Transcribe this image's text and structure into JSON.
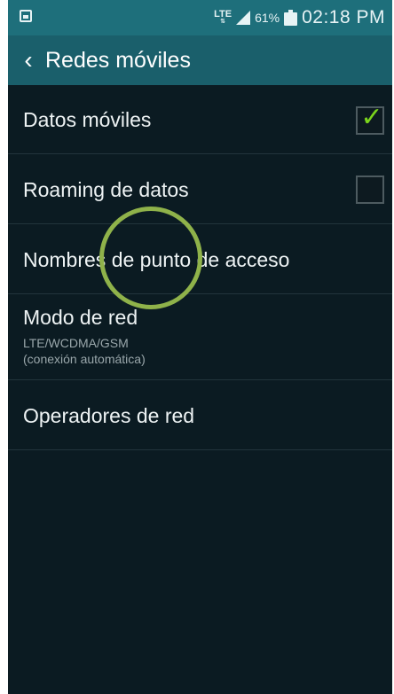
{
  "status_bar": {
    "network": "LTE",
    "battery_percent": "61%",
    "time": "02:18 PM"
  },
  "action_bar": {
    "title": "Redes móviles"
  },
  "items": [
    {
      "label": "Datos móviles",
      "checked": true
    },
    {
      "label": "Roaming de datos",
      "checked": false
    },
    {
      "label": "Nombres de punto de acceso"
    },
    {
      "label": "Modo de red",
      "subtitle_1": "LTE/WCDMA/GSM",
      "subtitle_2": "(conexión automática)"
    },
    {
      "label": "Operadores de red"
    }
  ],
  "colors": {
    "status_bar": "#1e6f7b",
    "action_bar": "#1a5f6b",
    "background": "#0b1b22",
    "check": "#7bd41c",
    "highlight_circle": "#8fb24a"
  }
}
